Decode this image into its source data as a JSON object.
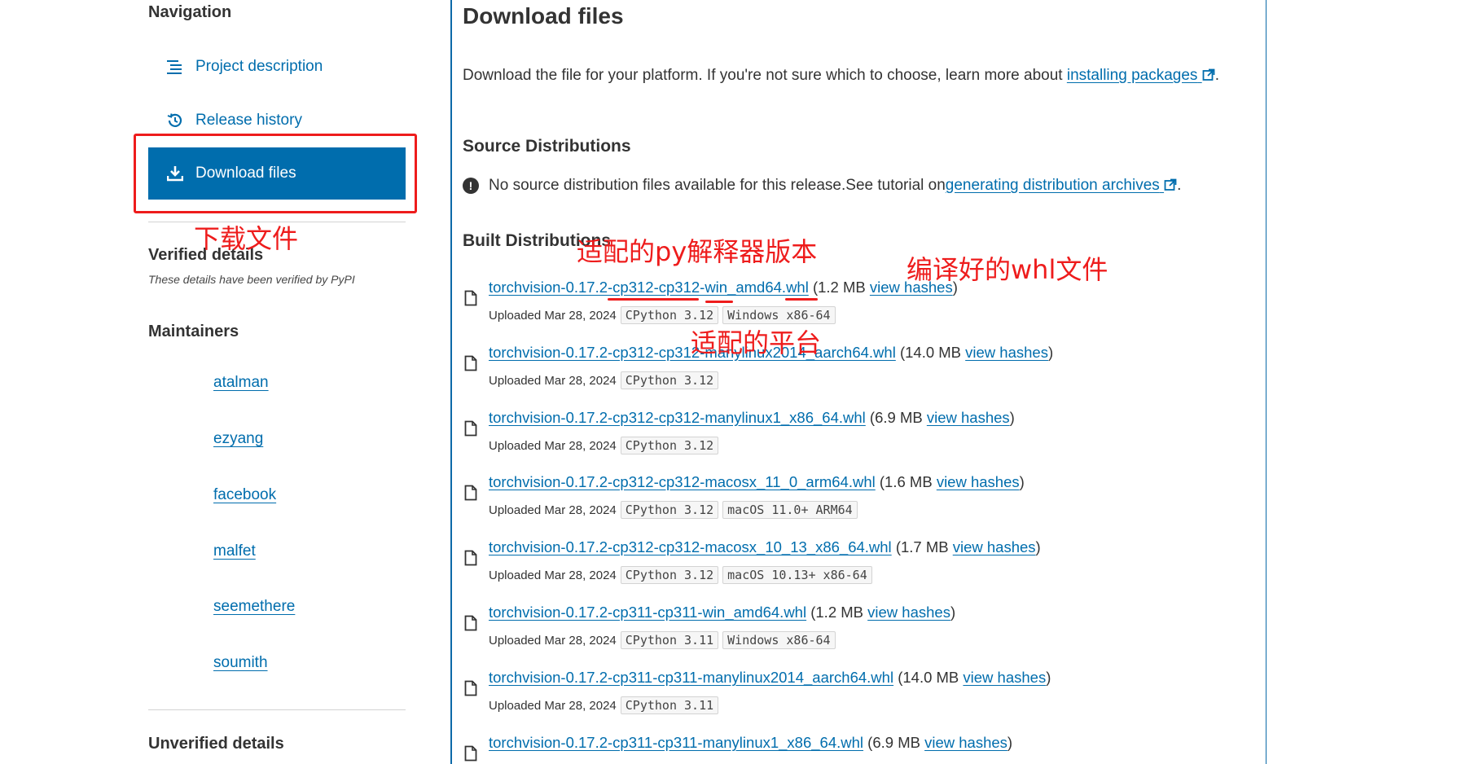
{
  "sidebar": {
    "heading": "Navigation",
    "items": [
      {
        "label": "Project description",
        "icon": "list-icon"
      },
      {
        "label": "Release history",
        "icon": "history-icon"
      },
      {
        "label": "Download files",
        "icon": "download-icon",
        "active": true
      }
    ],
    "verified": {
      "title": "Verified details",
      "note": "These details have been verified by PyPI"
    },
    "maintainers": {
      "title": "Maintainers",
      "list": [
        "atalman",
        "ezyang",
        "facebook",
        "malfet",
        "seemethere",
        "soumith"
      ]
    },
    "unverified_title": "Unverified details"
  },
  "main": {
    "title": "Download files",
    "intro_text": "Download the file for your platform. If you're not sure which to choose, learn more about ",
    "intro_link": "installing packages",
    "intro_end": ".",
    "source": {
      "title": "Source Distributions",
      "text": "No source distribution files available for this release.See tutorial on ",
      "link": "generating distribution archives",
      "end": "."
    },
    "built_title": "Built Distributions",
    "files": [
      {
        "name": "torchvision-0.17.2-cp312-cp312-win_amd64.whl",
        "size": "(1.2 MB",
        "hashes": "view hashes",
        "close": ")",
        "uploaded": "Uploaded Mar 28, 2024",
        "tags": [
          "CPython 3.12",
          "Windows x86-64"
        ]
      },
      {
        "name": "torchvision-0.17.2-cp312-cp312-manylinux2014_aarch64.whl",
        "size": "(14.0 MB",
        "hashes": "view hashes",
        "close": ")",
        "uploaded": "Uploaded Mar 28, 2024",
        "tags": [
          "CPython 3.12"
        ]
      },
      {
        "name": "torchvision-0.17.2-cp312-cp312-manylinux1_x86_64.whl",
        "size": "(6.9 MB",
        "hashes": "view hashes",
        "close": ")",
        "uploaded": "Uploaded Mar 28, 2024",
        "tags": [
          "CPython 3.12"
        ]
      },
      {
        "name": "torchvision-0.17.2-cp312-cp312-macosx_11_0_arm64.whl",
        "size": "(1.6 MB",
        "hashes": "view hashes",
        "close": ")",
        "uploaded": "Uploaded Mar 28, 2024",
        "tags": [
          "CPython 3.12",
          "macOS 11.0+ ARM64"
        ]
      },
      {
        "name": "torchvision-0.17.2-cp312-cp312-macosx_10_13_x86_64.whl",
        "size": "(1.7 MB",
        "hashes": "view hashes",
        "close": ")",
        "uploaded": "Uploaded Mar 28, 2024",
        "tags": [
          "CPython 3.12",
          "macOS 10.13+ x86-64"
        ]
      },
      {
        "name": "torchvision-0.17.2-cp311-cp311-win_amd64.whl",
        "size": "(1.2 MB",
        "hashes": "view hashes",
        "close": ")",
        "uploaded": "Uploaded Mar 28, 2024",
        "tags": [
          "CPython 3.11",
          "Windows x86-64"
        ]
      },
      {
        "name": "torchvision-0.17.2-cp311-cp311-manylinux2014_aarch64.whl",
        "size": "(14.0 MB",
        "hashes": "view hashes",
        "close": ")",
        "uploaded": "Uploaded Mar 28, 2024",
        "tags": [
          "CPython 3.11"
        ]
      },
      {
        "name": "torchvision-0.17.2-cp311-cp311-manylinux1_x86_64.whl",
        "size": "(6.9 MB",
        "hashes": "view hashes",
        "close": ")",
        "uploaded": "",
        "tags": []
      }
    ]
  },
  "annotations": {
    "download_files": "下载文件",
    "py_version": "适配的py解释器版本",
    "whl_file": "编译好的whl文件",
    "platform": "适配的平台"
  },
  "colors": {
    "link": "#006dad",
    "active_bg": "#006dad",
    "annotation": "#ee1c1c",
    "divider": "#0c6aa8"
  }
}
